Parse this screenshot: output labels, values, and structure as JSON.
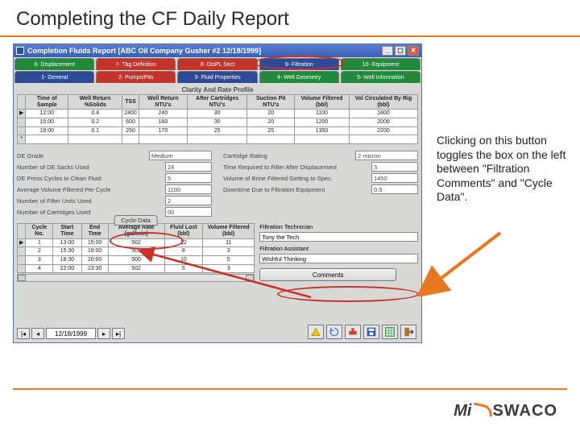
{
  "slide": {
    "title": "Completing the CF Daily Report",
    "callout": "Clicking on this button toggles the box on the left between \"Filtration Comments\" and \"Cycle Data\"."
  },
  "window": {
    "title": "Completion Fluids Report [ABC Oil Company  Gusher #2  12/18/1999]",
    "tabs_top": [
      "6- Displacement",
      "7- Tbg Definition",
      "8- DisPL Sect",
      "9- Filtration",
      "10- Equipment"
    ],
    "tabs_bot": [
      "1- General",
      "2- Pumps/Pits",
      "3- Fluid Properties",
      "4- Well Geometry",
      "5- Well Information"
    ],
    "section1_title": "Clarity And Rate Profile",
    "grid1": {
      "headers": [
        "Time of Sample",
        "Well Return %Solids",
        "TSS",
        "Well Return NTU's",
        "After Cartridges NTU's",
        "Suction Pit NTU's",
        "Volume Filtered (bbl)",
        "Vol Circulated By Rig (bbl)"
      ],
      "rows": [
        [
          "12:00",
          "0.4",
          "2400",
          "240",
          "30",
          "20",
          "1100",
          "1800"
        ],
        [
          "15:00",
          "0.2",
          "600",
          "180",
          "30",
          "20",
          "1200",
          "2000"
        ],
        [
          "18:00",
          "0.1",
          "250",
          "170",
          "25",
          "25",
          "1350",
          "2200"
        ]
      ]
    },
    "fields_left": [
      {
        "label": "DE Grade",
        "value": "Medium"
      },
      {
        "label": "Number of DE Sacks Used",
        "value": "24"
      },
      {
        "label": "DE Press Cycles to Clean Fluid",
        "value": "5"
      },
      {
        "label": "Average Volume Filtered Per Cycle",
        "value": "1100"
      },
      {
        "label": "Number of Filter Units Used",
        "value": "2"
      },
      {
        "label": "Number of Cartridges Used",
        "value": "00"
      }
    ],
    "fields_right": [
      {
        "label": "Cartridge Rating",
        "value": "2 micron"
      },
      {
        "label": "Time Required to Filter After Displacement",
        "value": "3"
      },
      {
        "label": "Volume of Brine Filtered Getting to Spec.",
        "value": "1450"
      },
      {
        "label": "Downtime Due to Filtration Equipment",
        "value": "0.5"
      }
    ],
    "cycle": {
      "tab_label": "Cycle Data",
      "grid": {
        "headers": [
          "Cycle No.",
          "Start Time",
          "End Time",
          "Average Rate (gal/min)",
          "Fluid Lost (bbl)",
          "Volume Filtered (bbl)"
        ],
        "rows": [
          [
            "1",
            "13:00",
            "15:00",
            "502",
            "12",
            "11"
          ],
          [
            "2",
            "15:30",
            "18:00",
            "501",
            "8",
            "3"
          ],
          [
            "3",
            "18:30",
            "20:00",
            "500",
            "10",
            "5"
          ],
          [
            "4",
            "22:00",
            "23:30",
            "502",
            "5",
            "3"
          ]
        ]
      },
      "tech_label": "Filtration Technician",
      "tech_value": "Tony the Tech",
      "asst_label": "Filtration Assistant",
      "asst_value": "Wishful Thinking",
      "comments_button": "Comments"
    },
    "nav_date": "12/18/1999",
    "icons": [
      "triangle-icon",
      "rotate-icon",
      "pump-icon",
      "save-icon",
      "grid-icon",
      "exit-icon"
    ]
  },
  "logo": {
    "mi": "Mi",
    "swaco": "SWACO"
  }
}
